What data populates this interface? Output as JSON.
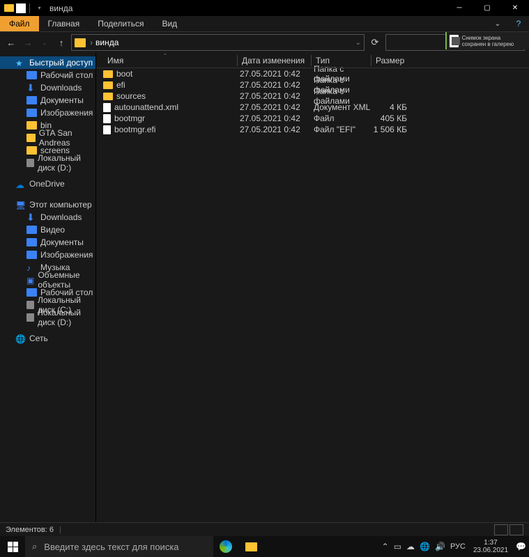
{
  "window": {
    "title": "винда"
  },
  "ribbon": {
    "file": "Файл",
    "tabs": [
      "Главная",
      "Поделиться",
      "Вид"
    ]
  },
  "address": {
    "path": "винда",
    "separator": "›"
  },
  "toast": {
    "text": "Снимок экрана сохранен в галерею"
  },
  "nav": {
    "quick": "Быстрый доступ",
    "quick_items": [
      "Рабочий стол",
      "Downloads",
      "Документы",
      "Изображения",
      "bin",
      "GTA San Andreas",
      "screens",
      "Локальный диск (D:)"
    ],
    "onedrive": "OneDrive",
    "thispc": "Этот компьютер",
    "pc_items": [
      "Downloads",
      "Видео",
      "Документы",
      "Изображения",
      "Музыка",
      "Объемные объекты",
      "Рабочий стол",
      "Локальный диск (C:)",
      "Локальный диск (D:)"
    ],
    "network": "Сеть"
  },
  "columns": {
    "name": "Имя",
    "date": "Дата изменения",
    "type": "Тип",
    "size": "Размер"
  },
  "files": [
    {
      "name": "boot",
      "date": "27.05.2021 0:42",
      "type": "Папка с файлами",
      "size": "",
      "icon": "folder"
    },
    {
      "name": "efi",
      "date": "27.05.2021 0:42",
      "type": "Папка с файлами",
      "size": "",
      "icon": "folder"
    },
    {
      "name": "sources",
      "date": "27.05.2021 0:42",
      "type": "Папка с файлами",
      "size": "",
      "icon": "folder"
    },
    {
      "name": "autounattend.xml",
      "date": "27.05.2021 0:42",
      "type": "Документ XML",
      "size": "4 КБ",
      "icon": "file"
    },
    {
      "name": "bootmgr",
      "date": "27.05.2021 0:42",
      "type": "Файл",
      "size": "405 КБ",
      "icon": "file"
    },
    {
      "name": "bootmgr.efi",
      "date": "27.05.2021 0:42",
      "type": "Файл \"EFI\"",
      "size": "1 506 КБ",
      "icon": "file"
    }
  ],
  "status": {
    "count": "Элементов: 6"
  },
  "taskbar": {
    "search_placeholder": "Введите здесь текст для поиска",
    "lang": "РУС",
    "time": "1:37",
    "date": "23.06.2021"
  }
}
